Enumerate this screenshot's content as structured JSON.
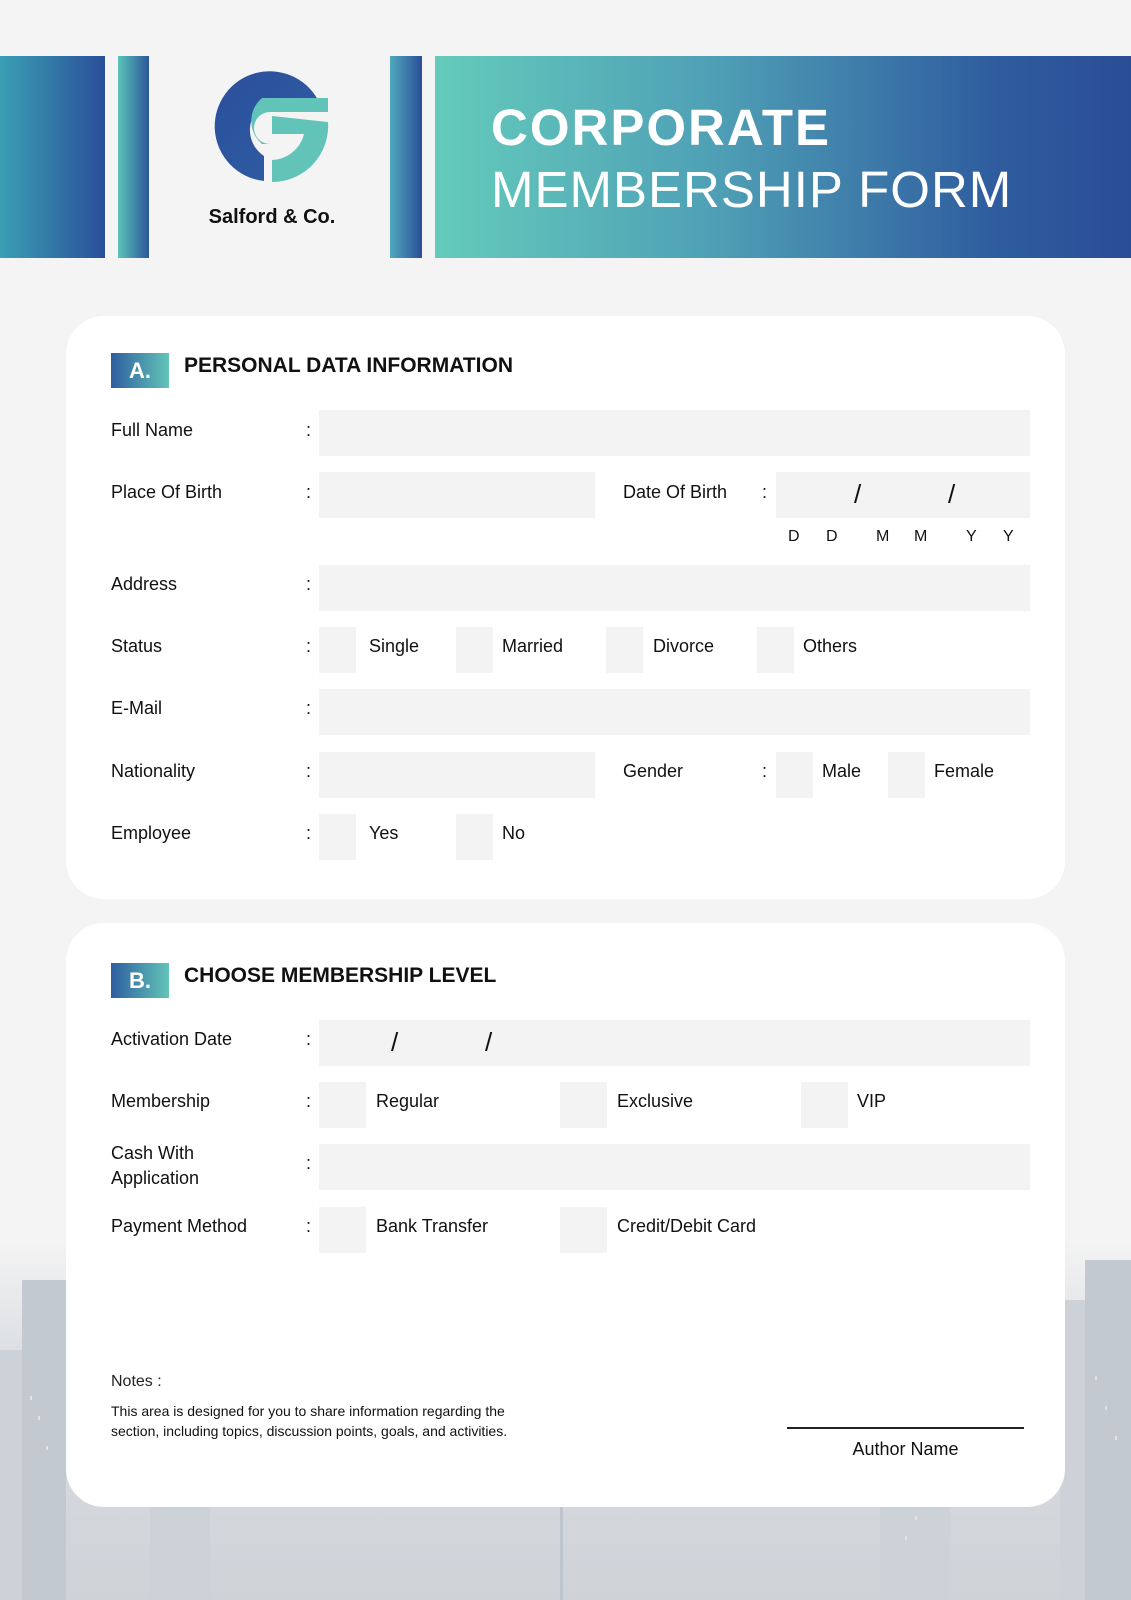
{
  "header": {
    "brand_name": "Salford & Co.",
    "title_line1": "CORPORATE",
    "title_line2": "MEMBERSHIP FORM",
    "logo_icon": "g-letter-logo-icon",
    "colors": {
      "teal": "#62c4b8",
      "blue": "#2a4d96"
    }
  },
  "section_a": {
    "badge": "A.",
    "title": "PERSONAL DATA INFORMATION",
    "colon": ":",
    "full_name_label": "Full Name",
    "place_of_birth_label": "Place Of Birth",
    "date_of_birth_label": "Date Of Birth",
    "date_slash": "/",
    "dob_hints": [
      "D",
      "D",
      "M",
      "M",
      "Y",
      "Y"
    ],
    "address_label": "Address",
    "status_label": "Status",
    "status_options": [
      "Single",
      "Married",
      "Divorce",
      "Others"
    ],
    "email_label": "E-Mail",
    "nationality_label": "Nationality",
    "gender_label": "Gender",
    "gender_options": [
      "Male",
      "Female"
    ],
    "employee_label": "Employee",
    "employee_options": [
      "Yes",
      "No"
    ]
  },
  "section_b": {
    "badge": "B.",
    "title": "CHOOSE MEMBERSHIP LEVEL",
    "colon": ":",
    "activation_date_label": "Activation Date",
    "date_slash": "/",
    "membership_label": "Membership",
    "membership_options": [
      "Regular",
      "Exclusive",
      "VIP"
    ],
    "cash_label_line1": "Cash With",
    "cash_label_line2": "Application",
    "payment_label": "Payment Method",
    "payment_options": [
      "Bank Transfer",
      "Credit/Debit Card"
    ],
    "notes_title": "Notes :",
    "notes_body": "This area is designed for you to share information regarding the section, including topics, discussion points, goals, and activities.",
    "author_name": "Author Name"
  }
}
